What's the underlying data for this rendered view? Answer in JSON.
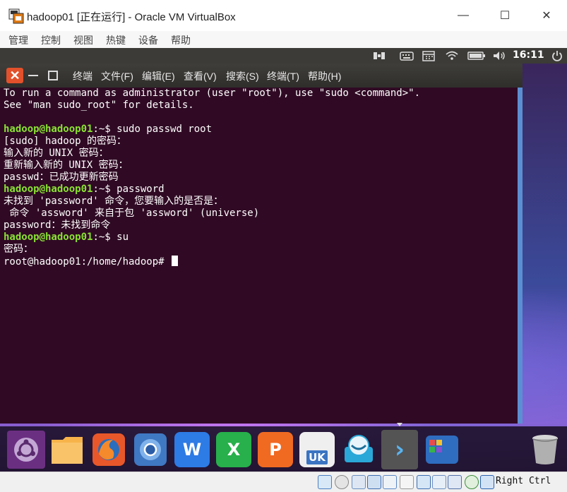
{
  "window": {
    "title": "hadoop01 [正在运行] - Oracle VM VirtualBox",
    "controls": {
      "minimize": "—",
      "maximize": "☐",
      "close": "✕"
    }
  },
  "vbox_menu": [
    "管理",
    "控制",
    "视图",
    "热键",
    "设备",
    "帮助"
  ],
  "guest_panel": {
    "clock": "16:11",
    "tray_icons": [
      "input-icon",
      "keyboard-icon",
      "calendar-icon",
      "wifi-icon",
      "battery-icon",
      "volume-icon",
      "power-icon"
    ]
  },
  "terminal": {
    "close_glyph": "✕",
    "menus": [
      "终端",
      "文件(F)",
      "编辑(E)",
      "查看(V)",
      "搜索(S)",
      "终端(T)",
      "帮助(H)"
    ],
    "lines": [
      {
        "text": "To run a command as administrator (user \"root\"), use \"sudo <command>\"."
      },
      {
        "text": "See \"man sudo_root\" for details."
      },
      {
        "text": ""
      },
      {
        "prompt": "hadoop@hadoop01",
        "rest": ":~$ sudo passwd root"
      },
      {
        "text": "[sudo] hadoop 的密码："
      },
      {
        "text": "输入新的 UNIX 密码："
      },
      {
        "text": "重新输入新的 UNIX 密码："
      },
      {
        "text": "passwd：已成功更新密码"
      },
      {
        "prompt": "hadoop@hadoop01",
        "rest": ":~$ password"
      },
      {
        "text": "未找到 'password' 命令，您要输入的是否是："
      },
      {
        "text": " 命令 'assword' 来自于包 'assword' (universe)"
      },
      {
        "text": "password：未找到命令"
      },
      {
        "prompt": "hadoop@hadoop01",
        "rest": ":~$ su"
      },
      {
        "text": "密码："
      },
      {
        "text": "root@hadoop01:/home/hadoop# ",
        "cursor": true
      }
    ]
  },
  "dock": {
    "items": [
      {
        "name": "ubuntu-icon",
        "label": "",
        "color": "#5a2a6e"
      },
      {
        "name": "files-icon",
        "label": "",
        "color": "#f2a93b"
      },
      {
        "name": "firefox-icon",
        "label": "",
        "color": "#e25b26"
      },
      {
        "name": "chromium-icon",
        "label": "",
        "color": "#5a8fd0"
      },
      {
        "name": "wps-writer-icon",
        "label": "W",
        "color": "#2d7be5"
      },
      {
        "name": "wps-sheets-icon",
        "label": "X",
        "color": "#27b04b"
      },
      {
        "name": "wps-presentation-icon",
        "label": "P",
        "color": "#f06a22"
      },
      {
        "name": "software-center-icon",
        "label": "UK",
        "color": "#e8e8e8"
      },
      {
        "name": "app-store-icon",
        "label": "",
        "color": "#7fc6e8"
      },
      {
        "name": "terminal-icon",
        "label": "›",
        "color": "#4c4c4c"
      },
      {
        "name": "workspace-switcher-icon",
        "label": "",
        "color": "#2f6fc0"
      },
      {
        "name": "trash-icon",
        "label": "",
        "color": "#9a9a9a"
      }
    ]
  },
  "statusbar": {
    "host_key": "Right Ctrl",
    "icons": [
      "hdd-icon",
      "optical-drive-icon",
      "audio-icon",
      "network-icon",
      "usb-icon",
      "shared-folder-icon",
      "display-icon",
      "recording-icon",
      "cpu-icon",
      "mouse-integration-icon",
      "download-icon"
    ]
  }
}
